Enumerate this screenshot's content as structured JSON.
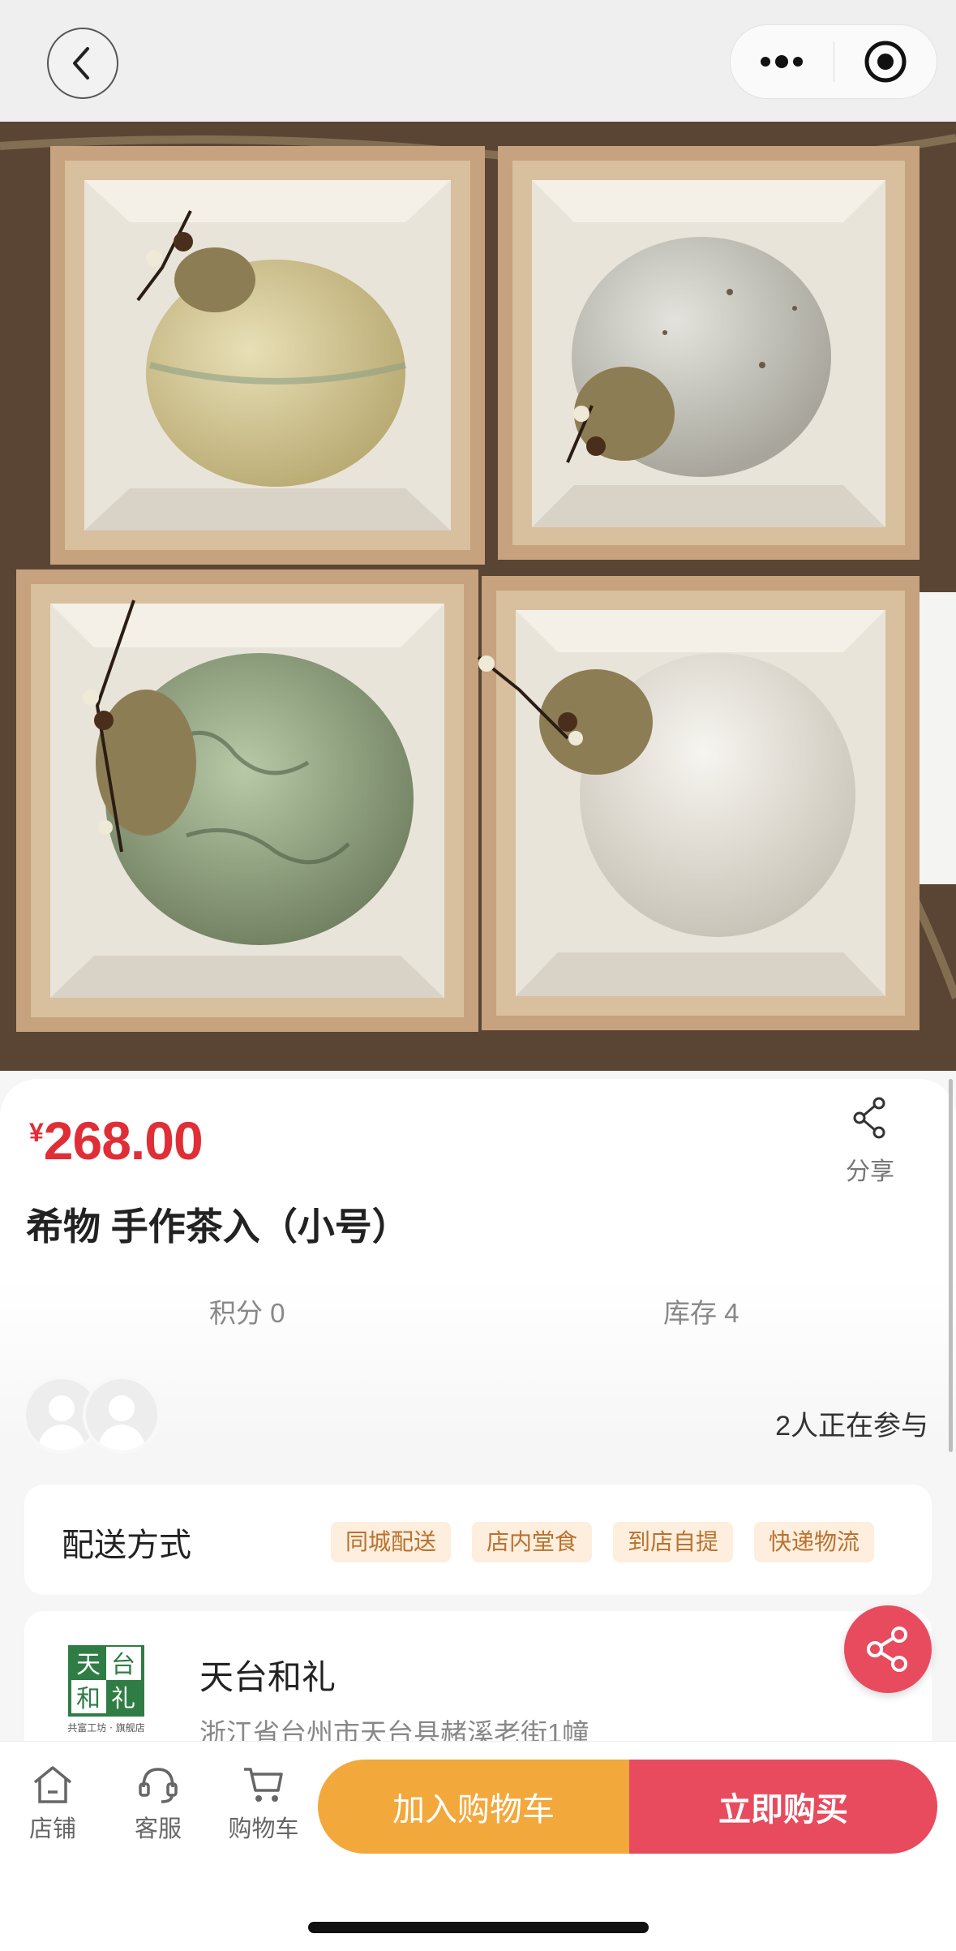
{
  "nav": {
    "back_icon": "chevron-left-icon",
    "more_icon": "more-dots-icon",
    "target_icon": "target-icon"
  },
  "product": {
    "currency": "¥",
    "price": "268.00",
    "title": "希物 手作茶入（小号）",
    "share_label": "分享",
    "points": "积分 0",
    "stock": "库存 4",
    "participants": "2人正在参与"
  },
  "delivery": {
    "label": "配送方式",
    "options": [
      "同城配送",
      "店内堂食",
      "到店自提",
      "快递物流"
    ]
  },
  "store": {
    "name": "天台和礼",
    "address": "浙江省台州市天台县赭溪老街1幢",
    "logo_chars": [
      "天",
      "台",
      "和",
      "礼"
    ],
    "logo_caption": "共富工坊 · 旗舰店"
  },
  "bottom_bar": {
    "shop": "店铺",
    "service": "客服",
    "cart": "购物车",
    "add_to_cart": "加入购物车",
    "buy_now": "立即购买"
  },
  "colors": {
    "price_red": "#e02e37",
    "cart_orange": "#f2a83b",
    "buy_red": "#e74b5d",
    "tag_bg": "#fdeedd",
    "tag_text": "#b9722f"
  }
}
